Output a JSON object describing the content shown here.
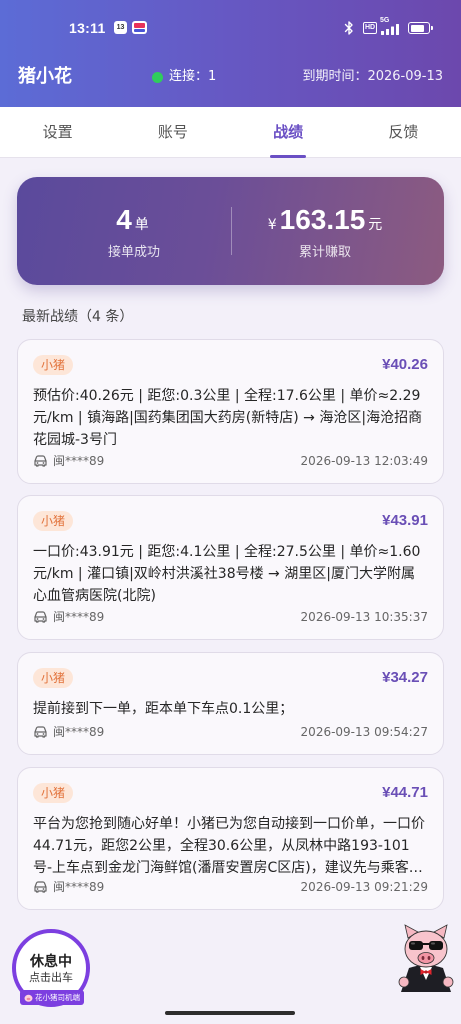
{
  "status_bar": {
    "time": "13:11",
    "calendar_date": "13",
    "hd_label": "HD",
    "network_type": "5G",
    "battery_level": 0.8,
    "icons": [
      "calendar-icon",
      "app-notification-icon",
      "bluetooth-icon",
      "hd-icon",
      "signal-icon",
      "battery-icon"
    ]
  },
  "header": {
    "title": "猪小花",
    "connection_text": "连接：1",
    "expiry_text": "到期时间：2026-09-13"
  },
  "tabs": [
    {
      "label": "设置",
      "active": false
    },
    {
      "label": "账号",
      "active": false
    },
    {
      "label": "战绩",
      "active": true
    },
    {
      "label": "反馈",
      "active": false
    }
  ],
  "stats": {
    "orders_value": "4",
    "orders_unit": "单",
    "orders_label": "接单成功",
    "earnings_currency": "¥",
    "earnings_value": "163.15",
    "earnings_unit": "元",
    "earnings_label": "累计赚取"
  },
  "records_section": {
    "title": "最新战绩（4 条）"
  },
  "records": [
    {
      "badge": "小猪",
      "price": "¥40.26",
      "detail": "预估价:40.26元 | 距您:0.3公里 | 全程:17.6公里 | 单价≈2.29元/km | 镇海路|国药集团国大药房(新特店) → 海沧区|海沧招商花园城-3号门",
      "plate": "闽****89",
      "time": "2026-09-13 12:03:49"
    },
    {
      "badge": "小猪",
      "price": "¥43.91",
      "detail": "一口价:43.91元 | 距您:4.1公里 | 全程:27.5公里 | 单价≈1.60元/km | 灌口镇|双岭村洪溪社38号楼 → 湖里区|厦门大学附属心血管病医院(北院)",
      "plate": "闽****89",
      "time": "2026-09-13 10:35:37"
    },
    {
      "badge": "小猪",
      "price": "¥34.27",
      "detail": "提前接到下一单，距本单下车点0.1公里；",
      "plate": "闽****89",
      "time": "2026-09-13 09:54:27"
    },
    {
      "badge": "小猪",
      "price": "¥44.71",
      "detail": "平台为您抢到随心好单！小猪已为您自动接到一口价单，一口价44.71元，距您2公里，全程30.6公里，从凤林中路193-101号-上车点到金龙门海鲜馆(潘厝安置房C区店)，建议先与乘客确认...",
      "plate": "闽****89",
      "time": "2026-09-13 09:21:29"
    }
  ],
  "bottom": {
    "status_button": {
      "title": "休息中",
      "subtitle": "点击出车"
    },
    "app_badge": "花小猪司机端",
    "mascot_icon": "pig-mascot-icon"
  },
  "colors": {
    "header_start": "#5c6cd6",
    "header_end": "#6c48ad",
    "accent": "#6a4fc4",
    "online_dot": "#2fcc5c",
    "badge_bg": "#fde6d8",
    "badge_text": "#e2733c",
    "status_ring": "#7c3fe0"
  }
}
